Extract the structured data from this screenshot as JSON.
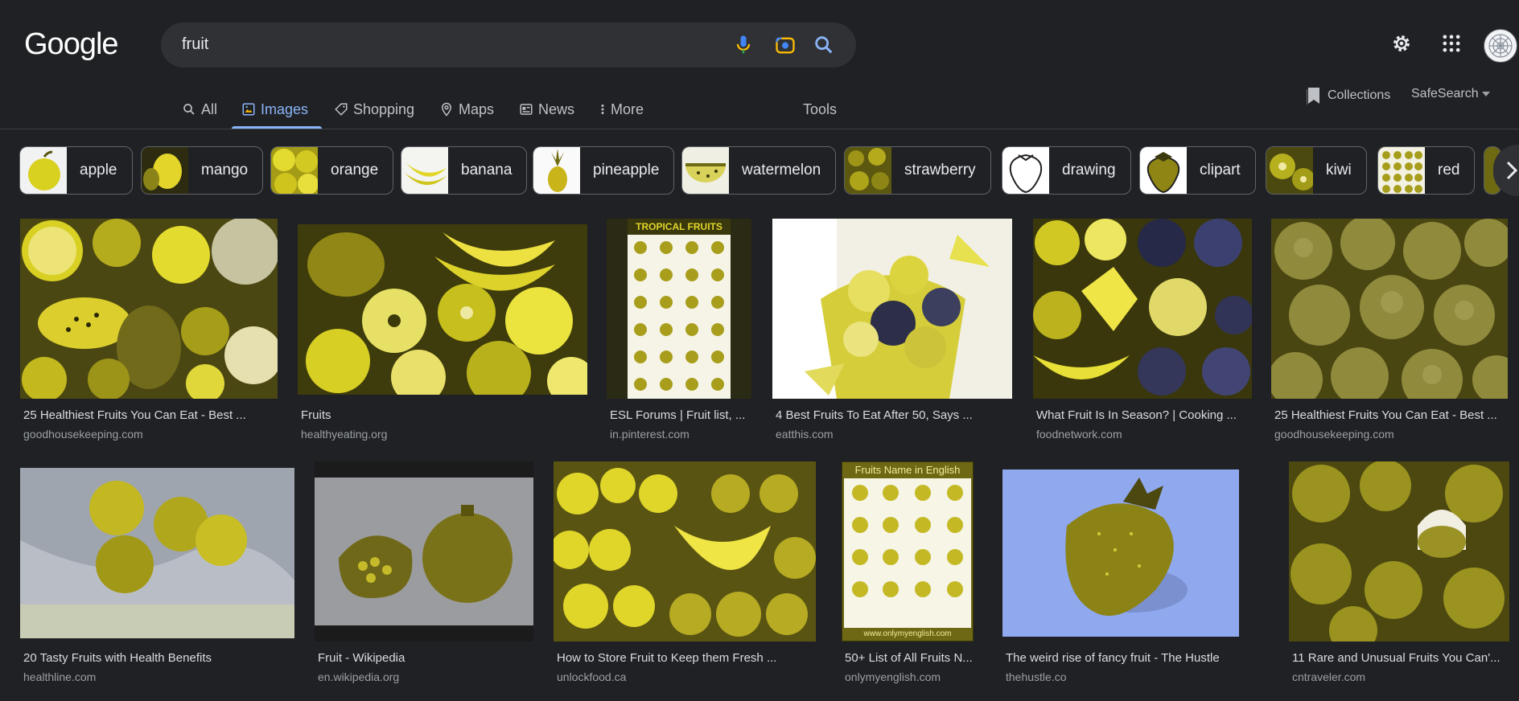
{
  "logo": "Google",
  "search": {
    "query": "fruit"
  },
  "tabs": [
    {
      "label": "All",
      "icon": "search-icon",
      "active": false
    },
    {
      "label": "Images",
      "icon": "image-icon",
      "active": true
    },
    {
      "label": "Shopping",
      "icon": "tag-icon",
      "active": false
    },
    {
      "label": "Maps",
      "icon": "pin-icon",
      "active": false
    },
    {
      "label": "News",
      "icon": "news-icon",
      "active": false
    },
    {
      "label": "More",
      "icon": "more-vert-icon",
      "active": false
    }
  ],
  "tools": "Tools",
  "collections": "Collections",
  "safesearch": "SafeSearch",
  "chips": [
    {
      "label": "apple"
    },
    {
      "label": "mango"
    },
    {
      "label": "orange"
    },
    {
      "label": "banana"
    },
    {
      "label": "pineapple"
    },
    {
      "label": "watermelon"
    },
    {
      "label": "strawberry"
    },
    {
      "label": "drawing"
    },
    {
      "label": "clipart"
    },
    {
      "label": "kiwi"
    },
    {
      "label": "red"
    }
  ],
  "results_row1": [
    {
      "title": "25 Healthiest Fruits You Can Eat - Best ...",
      "site": "goodhousekeeping.com"
    },
    {
      "title": "Fruits",
      "site": "healthyeating.org"
    },
    {
      "title": "ESL Forums | Fruit list, ...",
      "site": "in.pinterest.com",
      "poster_title": "TROPICAL FRUITS"
    },
    {
      "title": "4 Best Fruits To Eat After 50, Says ...",
      "site": "eatthis.com"
    },
    {
      "title": "What Fruit Is In Season? | Cooking ...",
      "site": "foodnetwork.com"
    },
    {
      "title": "25 Healthiest Fruits You Can Eat - Best ...",
      "site": "goodhousekeeping.com"
    }
  ],
  "results_row2": [
    {
      "title": "20 Tasty Fruits with Health Benefits",
      "site": "healthline.com"
    },
    {
      "title": "Fruit - Wikipedia",
      "site": "en.wikipedia.org"
    },
    {
      "title": "How to Store Fruit to Keep them Fresh ...",
      "site": "unlockfood.ca"
    },
    {
      "title": "50+ List of All Fruits N...",
      "site": "onlymyenglish.com",
      "poster_title": "Fruits Name in English",
      "poster_footer": "www.onlymyenglish.com"
    },
    {
      "title": "The weird rise of fancy fruit - The Hustle",
      "site": "thehustle.co"
    },
    {
      "title": "11 Rare and Unusual Fruits You Can'...",
      "site": "cntraveler.com"
    }
  ],
  "colors": {
    "background": "#202124",
    "accent": "#8ab4f8",
    "fruit_yellow": "#d4c91c",
    "fruit_olive": "#6e6a12"
  }
}
